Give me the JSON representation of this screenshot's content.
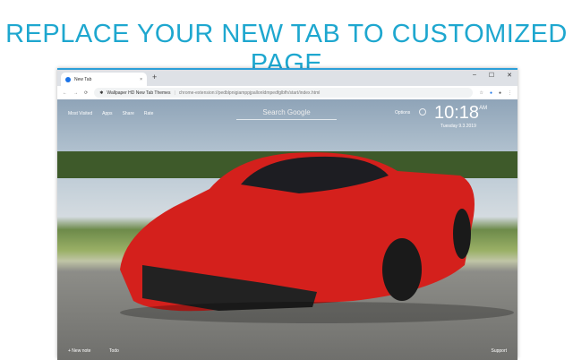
{
  "headline": "REPLACE YOUR NEW TAB TO CUSTOMIZED PAGE",
  "browser": {
    "tab_title": "New Tab",
    "tab_close": "×",
    "new_tab": "+",
    "win_controls": [
      "–",
      "☐",
      "✕"
    ],
    "site_name": "Wallpaper HD New Tab Themes",
    "url": "chrome-extension://pedblpnigiamppjpallonldmpedfglbfh/start/index.html"
  },
  "page": {
    "nav": [
      "Most Visited",
      "Apps",
      "Share",
      "Rate"
    ],
    "search_placeholder": "Search Google",
    "options": "Options",
    "time": "10:18",
    "ampm": "AM",
    "date": "Tuesday 9.3.2019",
    "new_note": "+ New note",
    "todo": "Todo",
    "support": "Support"
  },
  "colors": {
    "accent": "#1ea7cf",
    "car": "#d4201c"
  }
}
